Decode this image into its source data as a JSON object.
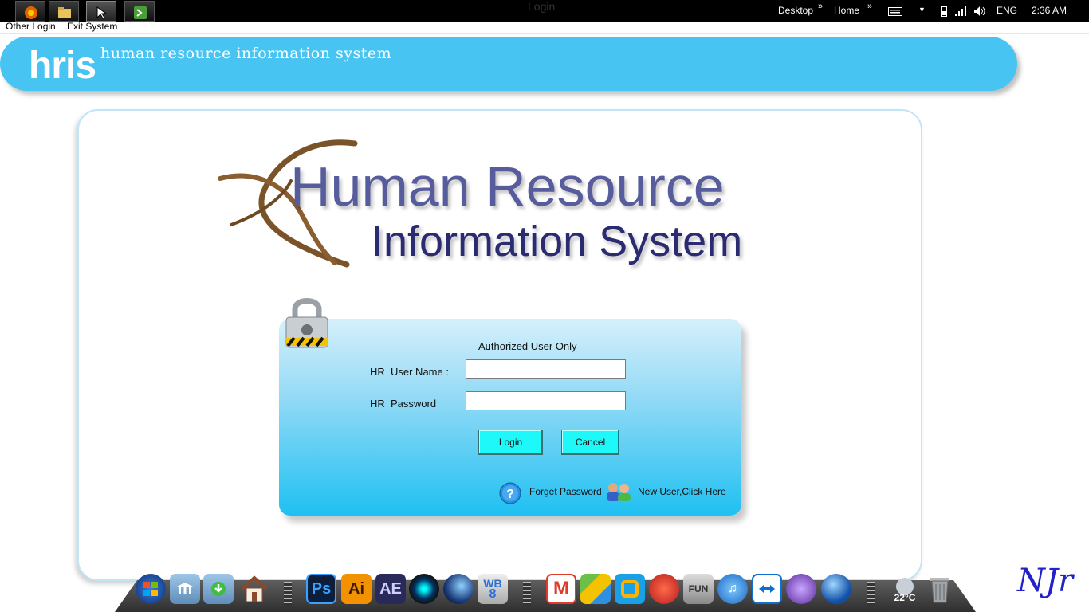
{
  "taskbar": {
    "buttons": [
      "firefox-icon",
      "file-explorer-icon",
      "cursor-app-icon",
      "terminal-icon"
    ],
    "window_title": "Login",
    "desktop_label": "Desktop",
    "home_label": "Home",
    "language": "ENG",
    "time": "2:36 AM"
  },
  "menu": {
    "items": [
      "Other Login",
      "Exit System"
    ]
  },
  "header": {
    "logo": "hris",
    "tagline": "human resource information system",
    "color": "#47c4f2"
  },
  "brand": {
    "title": "Human Resource",
    "subtitle": "Information System"
  },
  "login": {
    "heading": "Authorized User Only",
    "username_label": "HR  User Name :",
    "password_label": "HR  Password",
    "username_value": "",
    "password_value": "",
    "login_button": "Login",
    "cancel_button": "Cancel",
    "forget_password": "Forget Password",
    "new_user": "New User,Click Here"
  },
  "dock": {
    "icons": [
      "windows-start-icon",
      "folder-icon",
      "library-icon",
      "download-folder-icon",
      "home-icon",
      "photoshop-icon",
      "illustrator-icon",
      "after-effects-icon",
      "camera-lens-icon",
      "cinema4d-icon",
      "wb8-icon",
      "mail-icon",
      "layers-icon",
      "browser-icon",
      "ccleaner-icon",
      "fun-drive-icon",
      "itunes-icon",
      "teamviewer-icon",
      "bittorrent-icon",
      "globe-icon",
      "weather-icon",
      "trash-icon"
    ],
    "weather_temp": "22°C"
  },
  "signature": "NJr"
}
